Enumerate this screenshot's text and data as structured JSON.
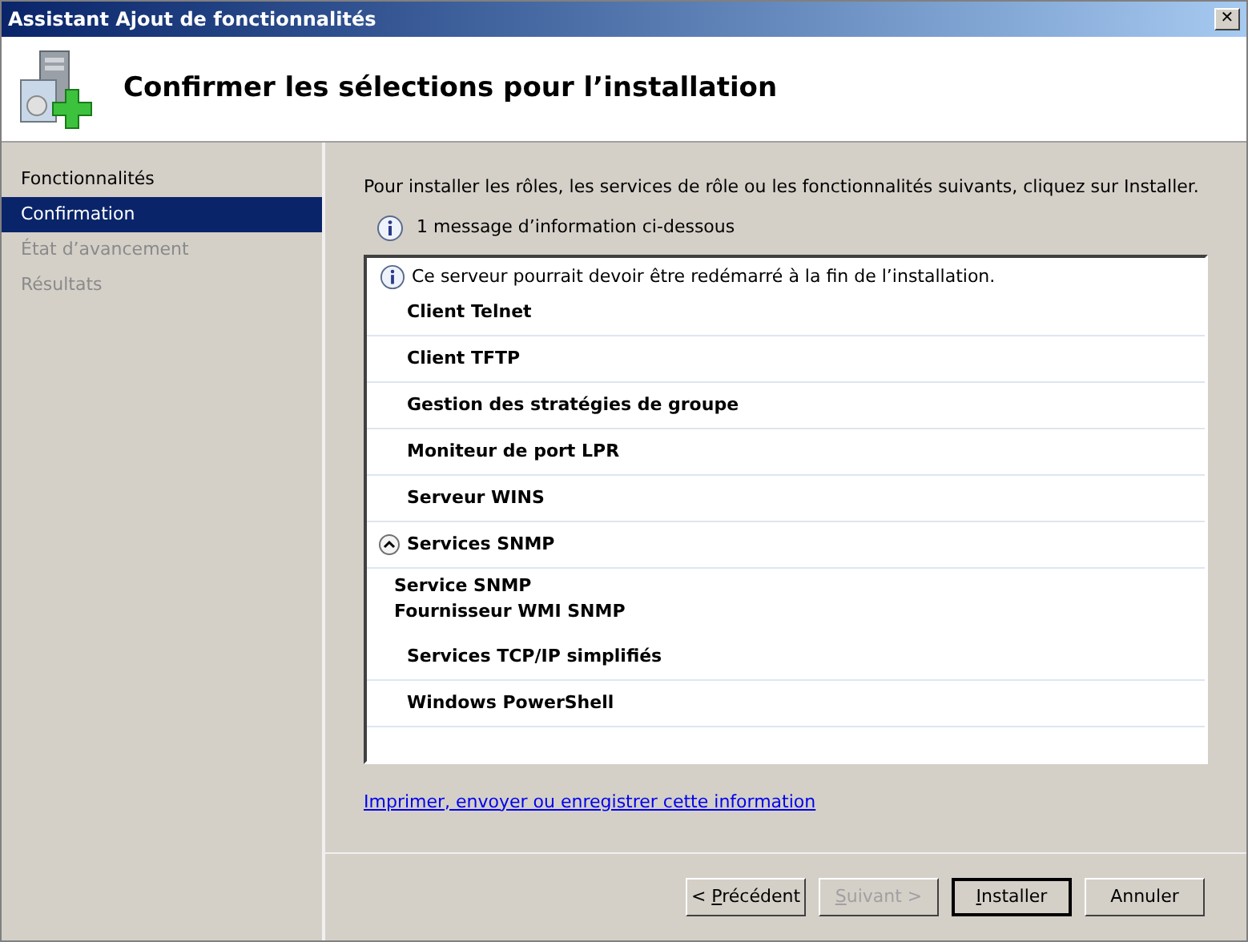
{
  "window": {
    "title": "Assistant Ajout de fonctionnalités",
    "close": "✕"
  },
  "header": {
    "title": "Confirmer les sélections pour l’installation"
  },
  "sidebar": {
    "items": [
      {
        "label": "Fonctionnalités",
        "selected": false,
        "disabled": false
      },
      {
        "label": "Confirmation",
        "selected": true,
        "disabled": false
      },
      {
        "label": "État d’avancement",
        "selected": false,
        "disabled": true
      },
      {
        "label": "Résultats",
        "selected": false,
        "disabled": true
      }
    ]
  },
  "content": {
    "intro": "Pour installer les rôles, les services de rôle ou les fonctionnalités suivants, cliquez sur Installer.",
    "message_count": "1 message d’information ci-dessous",
    "list": {
      "notice": "Ce serveur pourrait devoir être redémarré à la fin de l’installation.",
      "items": [
        {
          "label": "Client Telnet"
        },
        {
          "label": "Client TFTP"
        },
        {
          "label": "Gestion des stratégies de groupe"
        },
        {
          "label": "Moniteur de port LPR"
        },
        {
          "label": "Serveur WINS"
        },
        {
          "label": "Services SNMP",
          "expanded": true,
          "children": [
            "Service SNMP",
            "Fournisseur WMI SNMP"
          ]
        },
        {
          "label": "Services TCP/IP simplifiés"
        },
        {
          "label": "Windows PowerShell"
        }
      ]
    },
    "link": "Imprimer, envoyer ou enregistrer cette information"
  },
  "buttons": [
    {
      "before": "< ",
      "key": "P",
      "after": "récédent",
      "disabled": false,
      "default": false
    },
    {
      "key": "S",
      "after": "uivant >",
      "disabled": true,
      "default": false
    },
    {
      "key": "I",
      "after": "nstaller",
      "disabled": false,
      "default": true
    },
    {
      "before": "Annuler",
      "disabled": false,
      "default": false
    }
  ]
}
